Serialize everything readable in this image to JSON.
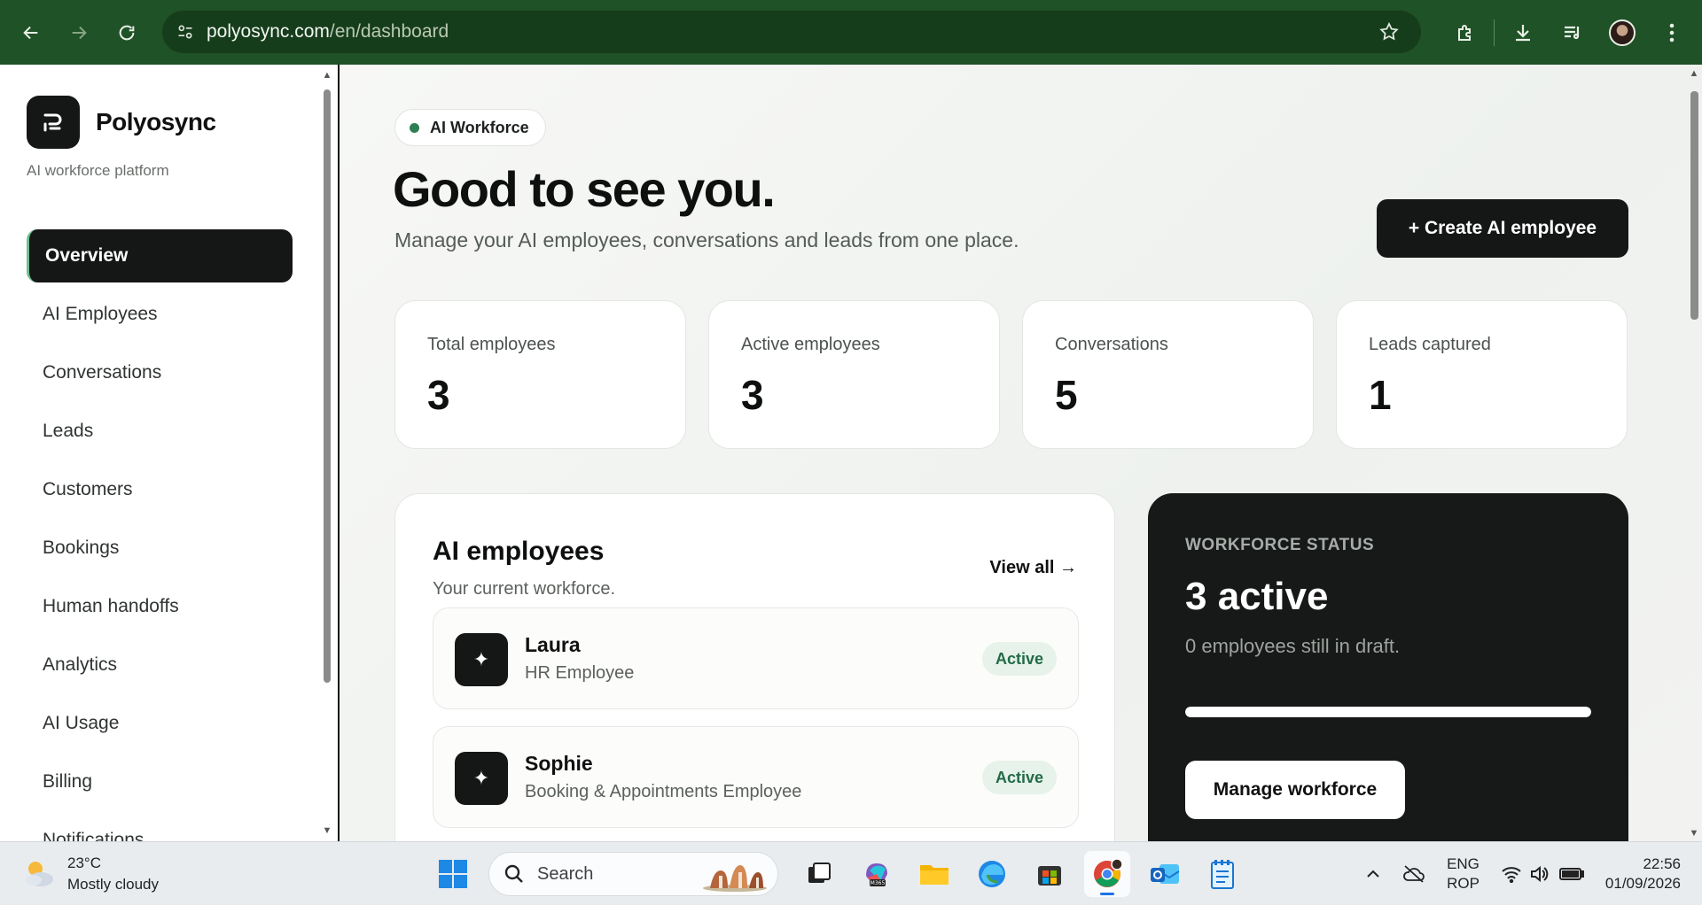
{
  "browser": {
    "url_host": "polyosync.com",
    "url_path": "/en/dashboard"
  },
  "sidebar": {
    "brand_name": "Polyosync",
    "brand_tagline": "AI workforce platform",
    "items": [
      {
        "label": "Overview",
        "active": true
      },
      {
        "label": "AI Employees"
      },
      {
        "label": "Conversations"
      },
      {
        "label": "Leads"
      },
      {
        "label": "Customers"
      },
      {
        "label": "Bookings"
      },
      {
        "label": "Human handoffs"
      },
      {
        "label": "Analytics"
      },
      {
        "label": "AI Usage"
      },
      {
        "label": "Billing"
      },
      {
        "label": "Notifications"
      }
    ]
  },
  "header": {
    "pill_label": "AI Workforce",
    "greeting": "Good to see you.",
    "subtitle": "Manage your AI employees, conversations and leads from one place.",
    "create_button": "+ Create AI employee"
  },
  "stats": [
    {
      "label": "Total employees",
      "value": "3"
    },
    {
      "label": "Active employees",
      "value": "3"
    },
    {
      "label": "Conversations",
      "value": "5"
    },
    {
      "label": "Leads captured",
      "value": "1"
    }
  ],
  "employees_card": {
    "title": "AI employees",
    "subtitle": "Your current workforce.",
    "view_all": "View all →",
    "rows": [
      {
        "name": "Laura",
        "role": "HR Employee",
        "status": "Active"
      },
      {
        "name": "Sophie",
        "role": "Booking & Appointments Employee",
        "status": "Active"
      }
    ]
  },
  "workforce_status": {
    "label": "WORKFORCE STATUS",
    "value": "3 active",
    "subtitle": "0 employees still in draft.",
    "progress_fraction": 1.0,
    "button": "Manage workforce"
  },
  "taskbar": {
    "weather_temp": "23°C",
    "weather_desc": "Mostly cloudy",
    "search_label": "Search",
    "lang_line1": "ENG",
    "lang_line2": "ROP",
    "time": "22:56",
    "date": "01/09/2026"
  },
  "colors": {
    "browser_chrome": "#1f5226",
    "accent_dark": "#151716",
    "badge_green": "#236b46"
  }
}
